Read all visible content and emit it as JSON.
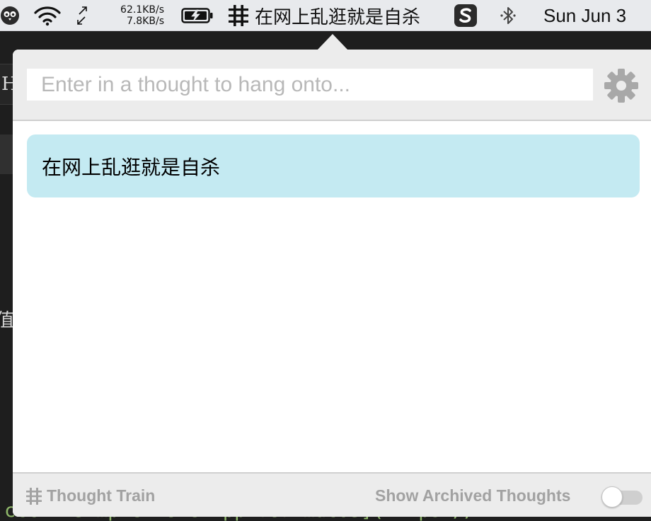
{
  "menubar": {
    "network": {
      "upload": "62.1KB/s",
      "download": "7.8KB/s"
    },
    "app_title": "在网上乱逛就是自杀",
    "clock": "Sun Jun 3",
    "icons": [
      "owl-icon",
      "wifi-icon",
      "network-arrows-icon",
      "battery-charging-icon",
      "train-track-icon",
      "sogou-input-icon",
      "bluetooth-icon"
    ]
  },
  "background": {
    "letter": "H",
    "glyph": "值",
    "code_line": "ccc - Simple Note App for macOS](https://"
  },
  "popover": {
    "input": {
      "placeholder": "Enter in a thought to hang onto...",
      "value": ""
    },
    "thoughts": [
      {
        "text": "在网上乱逛就是自杀"
      }
    ],
    "footer": {
      "brand": "Thought Train",
      "archived_label": "Show Archived Thoughts",
      "archived_on": false
    }
  },
  "colors": {
    "card": "#c4eaf2",
    "chrome": "#ececec",
    "muted_text": "#a2a2a2"
  }
}
